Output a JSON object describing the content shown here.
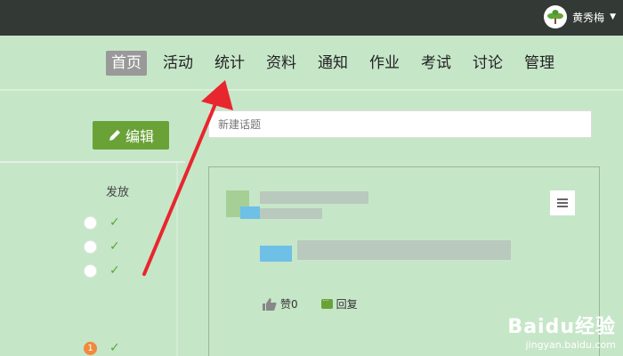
{
  "user": {
    "name": "黄秀梅"
  },
  "nav": {
    "items": [
      {
        "label": "首页",
        "active": true
      },
      {
        "label": "活动"
      },
      {
        "label": "统计"
      },
      {
        "label": "资料"
      },
      {
        "label": "通知"
      },
      {
        "label": "作业"
      },
      {
        "label": "考试"
      },
      {
        "label": "讨论"
      },
      {
        "label": "管理"
      }
    ]
  },
  "left": {
    "edit_label": "编辑",
    "column_header": "发放",
    "badge_number": "1"
  },
  "topic": {
    "placeholder": "新建话题"
  },
  "post": {
    "like_label": "赞0",
    "reply_label": "回复"
  },
  "watermark": {
    "logo": "Baidu经验",
    "url": "jingyan.baidu.com"
  },
  "colors": {
    "accent": "#6aa238",
    "arrow": "#e8262d",
    "topbar": "#333a36"
  }
}
